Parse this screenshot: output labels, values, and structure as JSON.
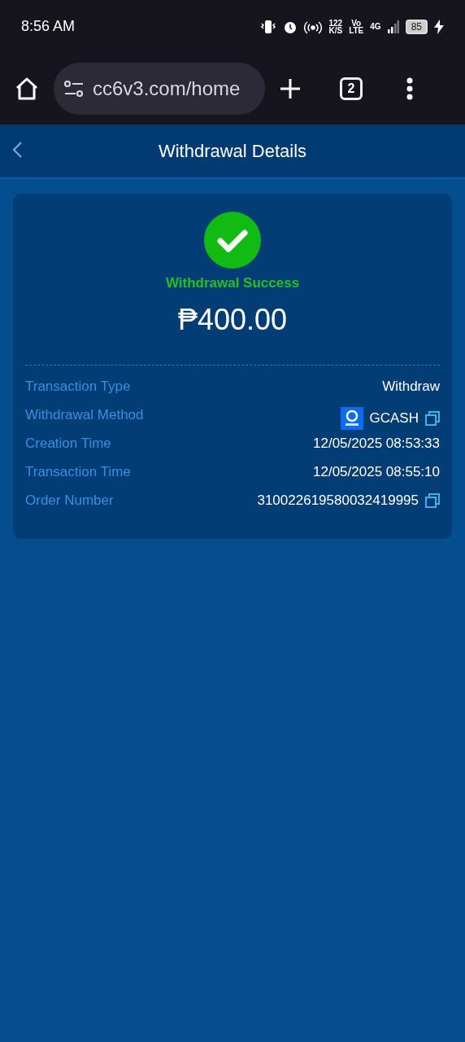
{
  "status_bar": {
    "time": "8:56 AM",
    "speed": "122",
    "speed_unit": "K/S",
    "volte_top": "Vo",
    "volte_bottom": "LTE",
    "network": "4G",
    "battery": "85"
  },
  "browser": {
    "url": "cc6v3.com/home",
    "tab_count": "2"
  },
  "header": {
    "title": "Withdrawal Details"
  },
  "result": {
    "status": "Withdrawal Success",
    "amount": "₱400.00"
  },
  "details": [
    {
      "kind": "plain",
      "label": "Transaction Type",
      "value": "Withdraw"
    },
    {
      "kind": "method",
      "label": "Withdrawal Method",
      "value": "GCASH"
    },
    {
      "kind": "plain",
      "label": "Creation Time",
      "value": "12/05/2025 08:53:33"
    },
    {
      "kind": "plain",
      "label": "Transaction Time",
      "value": "12/05/2025 08:55:10"
    },
    {
      "kind": "copy",
      "label": "Order Number",
      "value": "310022619580032419995"
    }
  ]
}
